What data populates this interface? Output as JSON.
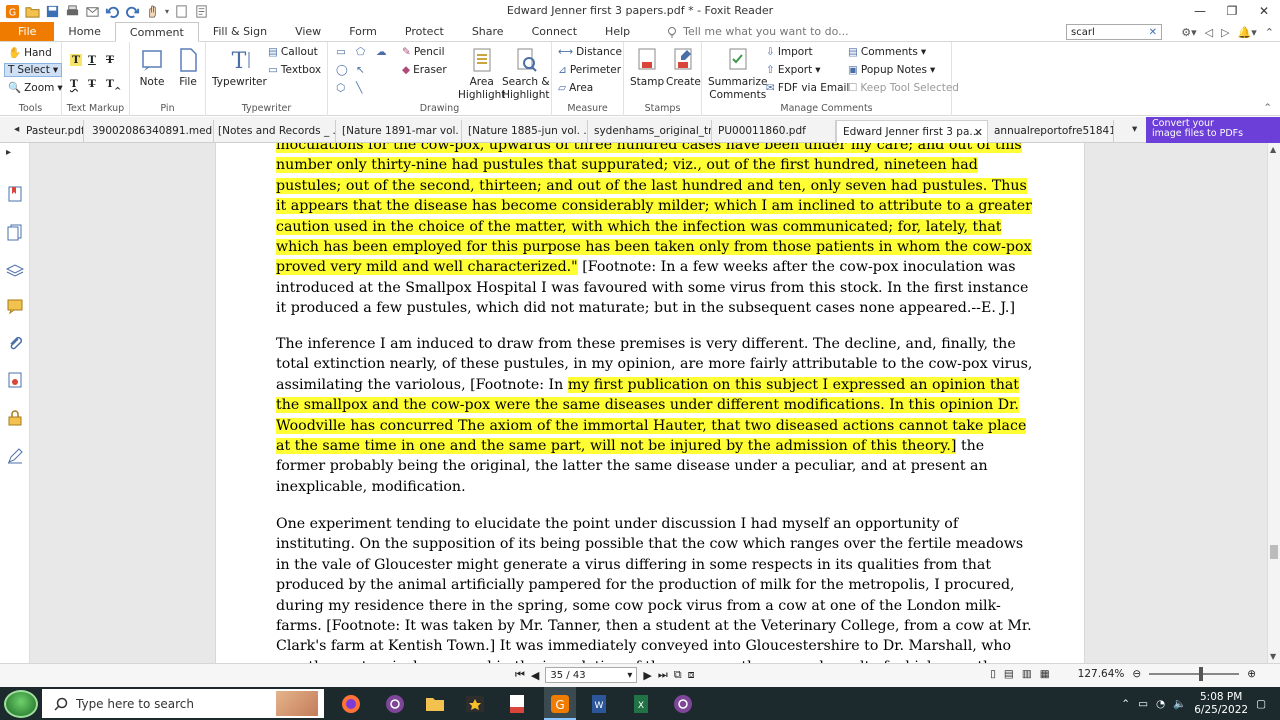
{
  "app": {
    "title": "Edward Jenner first 3 papers.pdf * - Foxit Reader",
    "window_buttons": [
      "—",
      "❐",
      "✕"
    ]
  },
  "ribbon_tabs": [
    "File",
    "Home",
    "Comment",
    "Fill & Sign",
    "View",
    "Form",
    "Protect",
    "Share",
    "Connect",
    "Help"
  ],
  "active_tab": "Comment",
  "tell_me_placeholder": "Tell me what you want to do...",
  "search_box_value": "scarl",
  "groups": {
    "tools": {
      "label": "Tools",
      "hand": "Hand",
      "select": "Select",
      "zoom": "Zoom"
    },
    "text_markup": {
      "label": "Text Markup"
    },
    "pin": {
      "label": "Pin",
      "note": "Note",
      "file": "File"
    },
    "typewriter": {
      "label": "Typewriter",
      "typewriter": "Typewriter",
      "callout": "Callout",
      "textbox": "Textbox"
    },
    "drawing": {
      "label": "Drawing",
      "pencil": "Pencil",
      "eraser": "Eraser",
      "area_highlight_1": "Area",
      "area_highlight_2": "Highlight",
      "search_highlight_1": "Search &",
      "search_highlight_2": "Highlight"
    },
    "measure": {
      "label": "Measure",
      "distance": "Distance",
      "perimeter": "Perimeter",
      "area": "Area"
    },
    "stamps": {
      "label": "Stamps",
      "stamp": "Stamp",
      "create": "Create"
    },
    "manage": {
      "label": "Manage Comments",
      "summarize_1": "Summarize",
      "summarize_2": "Comments",
      "import": "Import",
      "export": "Export",
      "fdf": "FDF via Email",
      "comments": "Comments",
      "popup_notes": "Popup Notes",
      "keep_tool": "Keep Tool Selected"
    }
  },
  "doc_tabs": [
    "Pasteur.pdf",
    "39002086340891.med....",
    "[Notes and Records _ ...",
    "[Nature 1891-mar vol. ...",
    "[Nature 1885-jun vol. ...",
    "sydenhams_original_tr...",
    "PU00011860.pdf",
    "Edward Jenner first 3 pa...",
    "annualreportofre51841..."
  ],
  "promo": {
    "line1": "Convert your",
    "line2": "image files to PDFs"
  },
  "document": {
    "p1": [
      {
        "t": "inoculations for the cow-pox, upwards of three hundred cases have been under my care; and out of this number only thirty-nine had pustules that suppurated; viz., out of the first hundred, nineteen had pustules; out of the second, thirteen; and out of the last hundred and ten, only seven had pustules. Thus it appears that the disease has become considerably milder; which I am inclined to attribute to a greater caution used in the choice of the matter, with which the infection was communicated; for, lately, that which has been employed for this purpose has been taken only from those patients in whom the cow-pox proved very mild and well characterized.\"",
        "hl": true
      },
      {
        "t": " [Footnote: In a few weeks after the cow-pox inoculation was introduced at the Smallpox Hospital I was favoured with some virus from this stock. In the first instance it produced a few pustules, which did not maturate; but in the subsequent cases none appeared.--E. J.]",
        "hl": false
      }
    ],
    "p2": [
      {
        "t": "The inference I am induced to draw from these premises is very different. The decline, and, finally, the total extinction nearly, of these pustules, in my opinion, are more fairly attributable to the cow-pox virus, assimilating the variolous, [Footnote: In ",
        "hl": false
      },
      {
        "t": "my first publication on this subject I expressed an opinion that the smallpox and the cow-pox were the same diseases under different modifications. In this opinion Dr. Woodville has concurred The axiom of the immortal Hauter, that two diseased actions cannot take place at the same time in one and the same part, will not be injured by the admission of this theory.]",
        "hl": true
      },
      {
        "t": " the former probably being the original, the latter the same disease under a peculiar, and at present an inexplicable, modification.",
        "hl": false
      }
    ],
    "p3": [
      {
        "t": "One experiment tending to elucidate the point under discussion I had myself an opportunity of instituting. On the supposition of its being possible that the cow which ranges over the fertile meadows in the vale of Gloucester might generate a virus differing in some respects in its qualities from that produced by the animal artificially pampered for the production of milk for the metropolis, I procured, during my residence there in the spring, some cow pock virus from a cow at one of the London milk- farms. [Footnote: It was taken by Mr. Tanner, then a student at the Veterinary College, from a cow at Mr. Clark's farm at Kentish Town.] It was immediately conveyed into Gloucestershire to Dr. Marshall, who was then extensively engaged in the inoculation of the cow-pox; the general result of which was, the virus was effectual, and in all respects answered",
        "hl": false
      }
    ]
  },
  "status": {
    "page": "35 / 43",
    "zoom": "127.64%"
  },
  "taskbar": {
    "search_placeholder": "Type here to search",
    "time": "5:08 PM",
    "date": "6/25/2022"
  },
  "colors": {
    "file_tab": "#ef7c00",
    "highlight": "#ffff33",
    "promo": "#6b3fd8"
  }
}
